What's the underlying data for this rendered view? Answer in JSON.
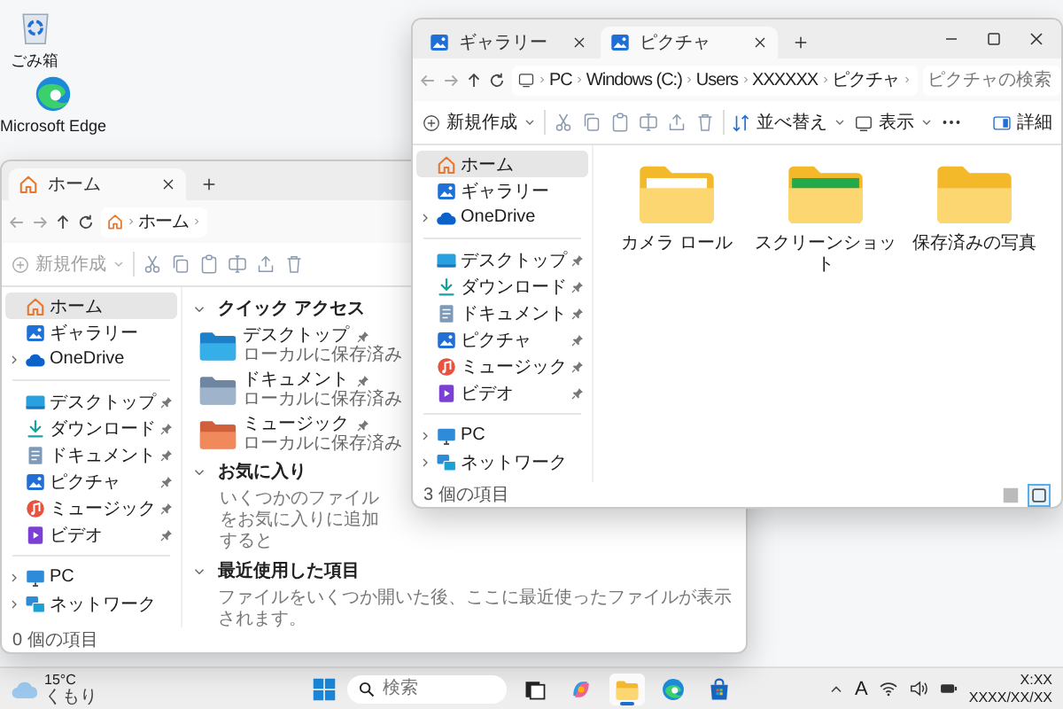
{
  "desktop_icons": [
    {
      "kind": "recycle-bin",
      "label": "ごみ箱"
    },
    {
      "kind": "edge",
      "label": "Microsoft Edge"
    }
  ],
  "windows": [
    {
      "active": false,
      "tabs": [
        {
          "kind": "home",
          "label": "ホーム",
          "selected": true
        }
      ],
      "address": {
        "kind": "home",
        "crumbs": [
          "ホーム"
        ]
      },
      "toolbar": {
        "new_label": "新規作成",
        "new_disabled": true
      },
      "sidebar": [
        {
          "kind": "home",
          "label": "ホーム",
          "selected": true,
          "expandable": false,
          "pinned": false
        },
        {
          "kind": "gallery",
          "label": "ギャラリー",
          "selected": false,
          "expandable": false,
          "pinned": false
        },
        {
          "kind": "onedrive",
          "label": "OneDrive",
          "selected": false,
          "expandable": true,
          "pinned": false
        },
        {
          "kind": "separator"
        },
        {
          "kind": "desktop",
          "label": "デスクトップ",
          "selected": false,
          "expandable": false,
          "pinned": true
        },
        {
          "kind": "download",
          "label": "ダウンロード",
          "selected": false,
          "expandable": false,
          "pinned": true
        },
        {
          "kind": "document",
          "label": "ドキュメント",
          "selected": false,
          "expandable": false,
          "pinned": true
        },
        {
          "kind": "pictures",
          "label": "ピクチャ",
          "selected": false,
          "expandable": false,
          "pinned": true
        },
        {
          "kind": "music",
          "label": "ミュージック",
          "selected": false,
          "expandable": false,
          "pinned": true
        },
        {
          "kind": "video",
          "label": "ビデオ",
          "selected": false,
          "expandable": false,
          "pinned": true
        },
        {
          "kind": "separator"
        },
        {
          "kind": "pc",
          "label": "PC",
          "selected": false,
          "expandable": true,
          "pinned": false
        },
        {
          "kind": "network",
          "label": "ネットワーク",
          "selected": false,
          "expandable": true,
          "pinned": false
        }
      ],
      "quick_access": {
        "title": "クイック アクセス",
        "expanded": true,
        "items": [
          {
            "kind": "desktop",
            "name": "デスクトップ",
            "detail": "ローカルに保存済み",
            "pinned": true
          },
          {
            "kind": "document",
            "name": "ドキュメント",
            "detail": "ローカルに保存済み",
            "pinned": true
          },
          {
            "kind": "music",
            "name": "ミュージック",
            "detail": "ローカルに保存済み",
            "pinned": true
          }
        ]
      },
      "sections": [
        {
          "title": "お気に入り",
          "expanded": true,
          "text": "いくつかのファイルをお気に入りに追加すると"
        },
        {
          "title": "最近使用した項目",
          "expanded": true,
          "text": "ファイルをいくつか開いた後、ここに最近使ったファイルが表示されます。"
        }
      ],
      "status": "0 個の項目"
    },
    {
      "active": true,
      "tabs": [
        {
          "kind": "gallery",
          "label": "ギャラリー",
          "selected": false
        },
        {
          "kind": "pictures",
          "label": "ピクチャ",
          "selected": true
        }
      ],
      "address": {
        "kind": "pc",
        "crumbs": [
          "PC",
          "Windows (C:)",
          "Users",
          "XXXXXX",
          "ピクチャ"
        ]
      },
      "search_placeholder": "ピクチャの検索",
      "toolbar": {
        "new_label": "新規作成",
        "new_disabled": false,
        "sort_label": "並べ替え",
        "view_label": "表示",
        "details_label": "詳細"
      },
      "sidebar": [
        {
          "kind": "home",
          "label": "ホーム",
          "selected": true,
          "expandable": false,
          "pinned": false
        },
        {
          "kind": "gallery",
          "label": "ギャラリー",
          "selected": false,
          "expandable": false,
          "pinned": false
        },
        {
          "kind": "onedrive",
          "label": "OneDrive",
          "selected": false,
          "expandable": true,
          "pinned": false
        },
        {
          "kind": "separator"
        },
        {
          "kind": "desktop",
          "label": "デスクトップ",
          "selected": false,
          "expandable": false,
          "pinned": true
        },
        {
          "kind": "download",
          "label": "ダウンロード",
          "selected": false,
          "expandable": false,
          "pinned": true
        },
        {
          "kind": "document",
          "label": "ドキュメント",
          "selected": false,
          "expandable": false,
          "pinned": true
        },
        {
          "kind": "pictures",
          "label": "ピクチャ",
          "selected": false,
          "expandable": false,
          "pinned": true
        },
        {
          "kind": "music",
          "label": "ミュージック",
          "selected": false,
          "expandable": false,
          "pinned": true
        },
        {
          "kind": "video",
          "label": "ビデオ",
          "selected": false,
          "expandable": false,
          "pinned": true
        },
        {
          "kind": "separator"
        },
        {
          "kind": "pc",
          "label": "PC",
          "selected": false,
          "expandable": true,
          "pinned": false
        },
        {
          "kind": "network",
          "label": "ネットワーク",
          "selected": false,
          "expandable": true,
          "pinned": false
        }
      ],
      "folders": [
        {
          "kind": "camera-roll",
          "name": "カメラ ロール"
        },
        {
          "kind": "screenshots",
          "name": "スクリーンショット"
        },
        {
          "kind": "saved",
          "name": "保存済みの写真"
        }
      ],
      "status": "3 個の項目",
      "view_buttons": [
        {
          "kind": "list",
          "selected": false
        },
        {
          "kind": "tiles",
          "selected": true
        }
      ]
    }
  ],
  "taskbar": {
    "weather": {
      "temperature": "15°C",
      "condition": "くもり"
    },
    "search_placeholder": "検索",
    "apps": [
      {
        "kind": "task-view",
        "active": false
      },
      {
        "kind": "copilot",
        "active": false
      },
      {
        "kind": "explorer",
        "active": true
      },
      {
        "kind": "edge",
        "active": false
      },
      {
        "kind": "store",
        "active": false
      }
    ],
    "ime": "A",
    "time": "X:XX",
    "date": "XXXX/XX/XX"
  }
}
